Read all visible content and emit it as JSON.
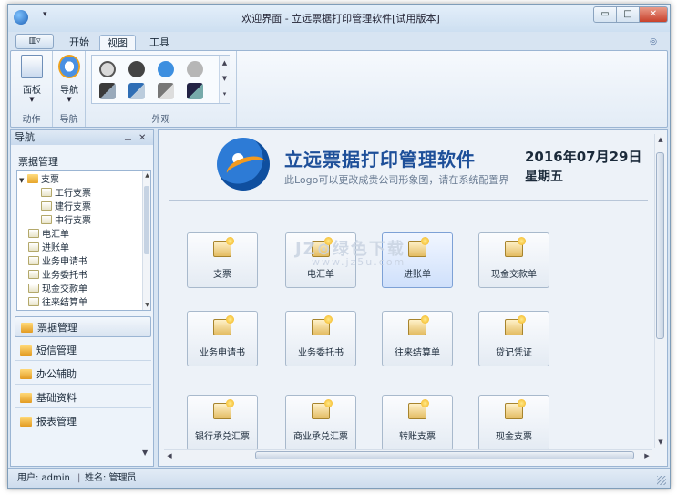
{
  "window": {
    "title": "欢迎界面 - 立远票据打印管理软件[试用版本]",
    "controls": {
      "minimize": "▭",
      "maximize": "□",
      "close": "✕"
    }
  },
  "ribbon": {
    "app_button_label": "▥▿",
    "tabs": [
      "开始",
      "视图",
      "工具"
    ],
    "active_tab": "视图",
    "groups": [
      {
        "label": "动作",
        "button": "面板"
      },
      {
        "label": "导航",
        "button": "导航"
      },
      {
        "label": "外观"
      }
    ]
  },
  "nav": {
    "header": "导航",
    "section_title": "票据管理",
    "tree": [
      {
        "label": "支票",
        "level": 0,
        "type": "folder",
        "expanded": true
      },
      {
        "label": "工行支票",
        "level": 1,
        "type": "doc"
      },
      {
        "label": "建行支票",
        "level": 1,
        "type": "doc"
      },
      {
        "label": "中行支票",
        "level": 1,
        "type": "doc"
      },
      {
        "label": "电汇单",
        "level": 0,
        "type": "doc"
      },
      {
        "label": "进账单",
        "level": 0,
        "type": "doc"
      },
      {
        "label": "业务申请书",
        "level": 0,
        "type": "doc"
      },
      {
        "label": "业务委托书",
        "level": 0,
        "type": "doc"
      },
      {
        "label": "现金交款单",
        "level": 0,
        "type": "doc"
      },
      {
        "label": "往来结算单",
        "level": 0,
        "type": "doc"
      }
    ],
    "buttons": [
      "票据管理",
      "短信管理",
      "办公辅助",
      "基础资料",
      "报表管理"
    ],
    "active_button": "票据管理"
  },
  "main": {
    "software_title": "立远票据打印管理软件",
    "logo_hint": "此Logo可以更改成贵公司形象图，请在系统配置界",
    "date": "2016年07月29日",
    "weekday": "星期五",
    "watermark": "JZ⊙绿色下载",
    "watermark_sub": "www.jz5u.com",
    "tiles": [
      "支票",
      "电汇单",
      "进账单",
      "现金交款单",
      "业务申请书",
      "业务委托书",
      "往来结算单",
      "贷记凭证",
      "银行承兑汇票",
      "商业承兑汇票",
      "转账支票",
      "现金支票"
    ],
    "hot_tile": "进账单"
  },
  "status": {
    "user": "用户: admin",
    "separator": "|",
    "name": "姓名: 管理员"
  },
  "colors": {
    "accent": "#1d4f99",
    "logo_orange": "#f39a1f",
    "logo_blue": "#2d7bd6"
  }
}
